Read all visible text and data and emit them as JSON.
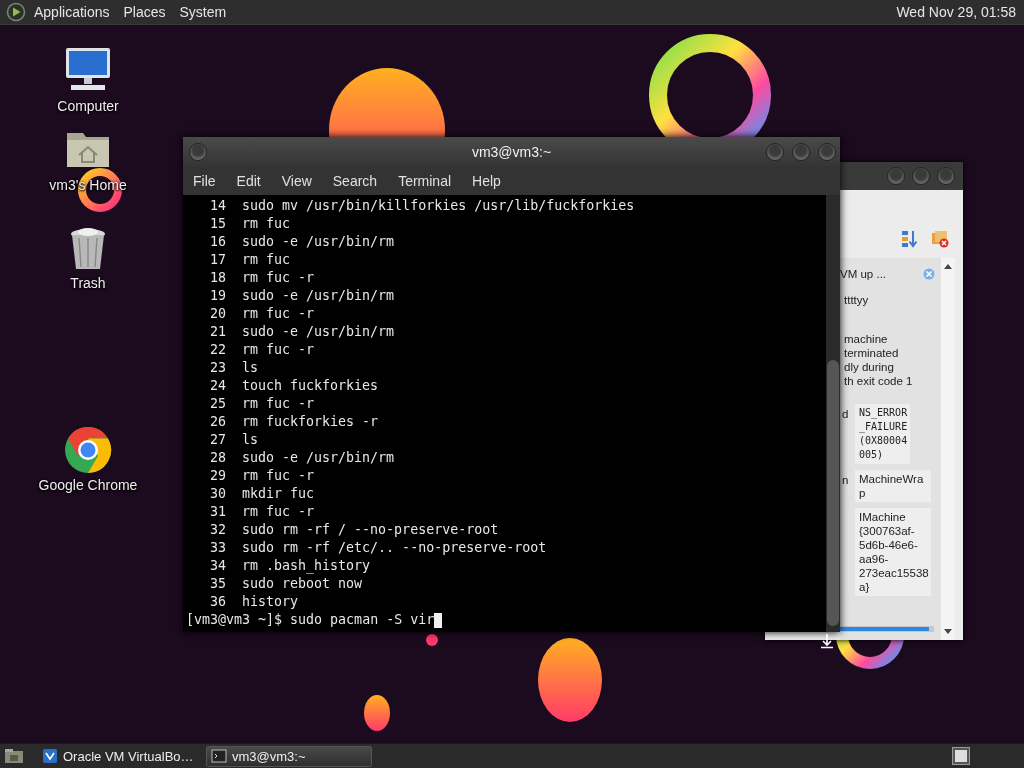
{
  "top_panel": {
    "menus": [
      "Applications",
      "Places",
      "System"
    ],
    "clock": "Wed Nov 29, 01:58"
  },
  "desktop_icons": [
    {
      "kind": "computer",
      "label": "Computer"
    },
    {
      "kind": "home",
      "label": "vm3's Home"
    },
    {
      "kind": "trash",
      "label": "Trash"
    },
    {
      "kind": "chrome",
      "label": "Google Chrome"
    }
  ],
  "background_window": {
    "notice_title": "VM up ...",
    "notice_subtitle": "ttttyy",
    "message_lines": [
      "machine",
      "terminated",
      "dly during",
      "th exit code 1"
    ],
    "details": [
      {
        "label": "d",
        "value": "NS_ERROR_FAILURE (0X80004005)",
        "kind": "mono"
      },
      {
        "label": "n",
        "value": "MachineWrap",
        "kind": "text"
      },
      {
        "value": "IMachine {300763af-5d6b-46e6-aa96-273eac15538a}",
        "kind": "text"
      }
    ],
    "progress": {
      "level": 0.95
    }
  },
  "terminal": {
    "title": "vm3@vm3:~",
    "menu": [
      "File",
      "Edit",
      "View",
      "Search",
      "Terminal",
      "Help"
    ],
    "history": [
      {
        "number": "14",
        "command": "sudo mv /usr/bin/killforkies /usr/lib/fuckforkies"
      },
      {
        "number": "15",
        "command": "rm fuc"
      },
      {
        "number": "16",
        "command": "sudo -e /usr/bin/rm"
      },
      {
        "number": "17",
        "command": "rm fuc"
      },
      {
        "number": "18",
        "command": "rm fuc -r"
      },
      {
        "number": "19",
        "command": "sudo -e /usr/bin/rm"
      },
      {
        "number": "20",
        "command": "rm fuc -r"
      },
      {
        "number": "21",
        "command": "sudo -e /usr/bin/rm"
      },
      {
        "number": "22",
        "command": "rm fuc -r"
      },
      {
        "number": "23",
        "command": "ls"
      },
      {
        "number": "24",
        "command": "touch fuckforkies"
      },
      {
        "number": "25",
        "command": "rm fuc -r"
      },
      {
        "number": "26",
        "command": "rm fuckforkies -r"
      },
      {
        "number": "27",
        "command": "ls"
      },
      {
        "number": "28",
        "command": "sudo -e /usr/bin/rm"
      },
      {
        "number": "29",
        "command": "rm fuc -r"
      },
      {
        "number": "30",
        "command": "mkdir fuc"
      },
      {
        "number": "31",
        "command": "rm fuc -r"
      },
      {
        "number": "32",
        "command": "sudo rm -rf / --no-preserve-root"
      },
      {
        "number": "33",
        "command": "sudo rm -rf /etc/.. --no-preserve-root"
      },
      {
        "number": "34",
        "command": "rm .bash_history"
      },
      {
        "number": "35",
        "command": "sudo reboot now"
      },
      {
        "number": "36",
        "command": "history"
      }
    ],
    "prompt": "[vm3@vm3 ~]$",
    "input": "sudo pacman -S vir"
  },
  "taskbar": {
    "items": [
      {
        "kind": "virtualbox",
        "label": "Oracle VM VirtualBo…",
        "selected": false
      },
      {
        "kind": "terminal",
        "label": "vm3@vm3:~",
        "selected": true
      }
    ]
  }
}
